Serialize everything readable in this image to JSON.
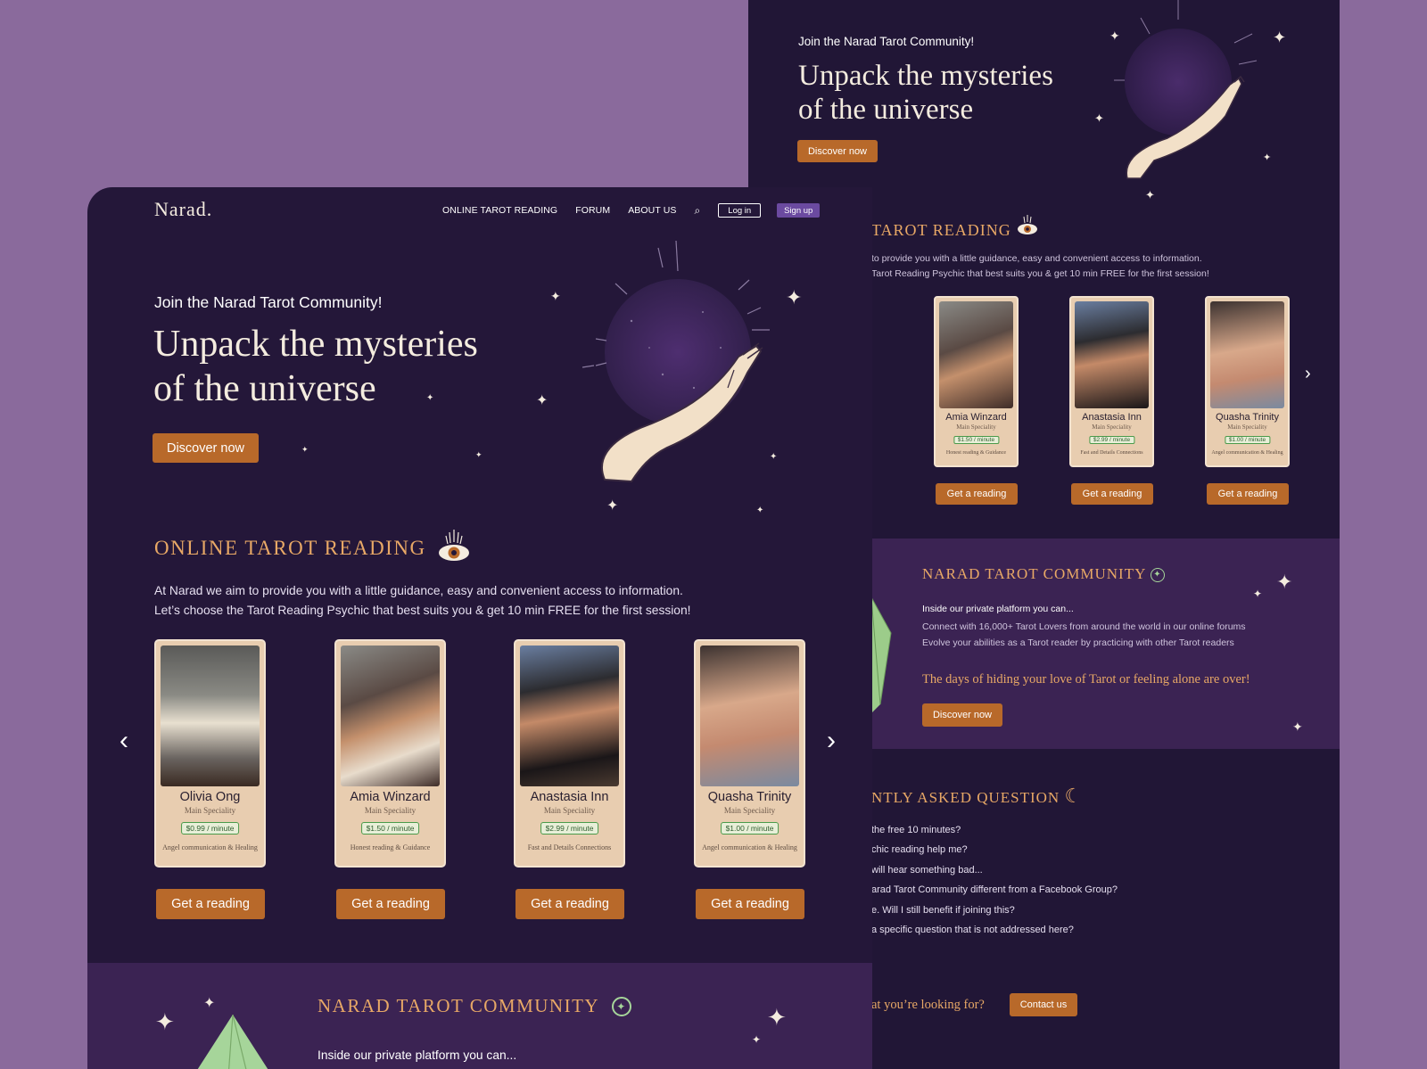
{
  "brand": {
    "logo": "Narad."
  },
  "nav": {
    "items": [
      "ONLINE TAROT READING",
      "FORUM",
      "ABOUT US"
    ],
    "login": "Log in",
    "signup": "Sign up"
  },
  "hero": {
    "kicker": "Join the Narad Tarot Community!",
    "title_line1": "Unpack the mysteries",
    "title_line2": "of the universe",
    "cta": "Discover now"
  },
  "reading": {
    "heading": "ONLINE TAROT READING",
    "desc_line1": "At Narad we aim to provide you with a little guidance, easy and convenient access to information.",
    "desc_line2": "Let’s choose the Tarot Reading Psychic that best suits you & get 10 min FREE for the first session!",
    "readers": [
      {
        "name": "Olivia Ong",
        "specialty_label": "Main Speciality",
        "price": "$0.99 / minute",
        "specialty": "Angel communication & Healing",
        "cta": "Get a reading"
      },
      {
        "name": "Amia Winzard",
        "specialty_label": "Main Speciality",
        "price": "$1.50 / minute",
        "specialty": "Honest reading & Guidance",
        "cta": "Get a reading"
      },
      {
        "name": "Anastasia Inn",
        "specialty_label": "Main Speciality",
        "price": "$2.99 / minute",
        "specialty": "Fast and Details Connections",
        "cta": "Get a reading"
      },
      {
        "name": "Quasha Trinity",
        "specialty_label": "Main Speciality",
        "price": "$1.00 / minute",
        "specialty": "Angel communication & Healing",
        "cta": "Get a reading"
      }
    ]
  },
  "community": {
    "heading": "NARAD TAROT COMMUNITY",
    "intro": "Inside our private platform you can...",
    "point1": "Connect with 16,000+ Tarot Lovers from around the world in our online forums",
    "point2": "Evolve your abilities as a Tarot reader by practicing with other Tarot readers",
    "quote": "The days of hiding your love of Tarot or feeling alone are over!",
    "cta": "Discover now"
  },
  "back": {
    "reading_heading_visible": "TAROT READING",
    "desc_line1_visible": "to provide you with a little guidance, easy and convenient access to information.",
    "desc_line2_visible": "Tarot Reading Psychic that best suits you & get 10 min FREE for the first session!",
    "faq_heading_visible": "NTLY ASKED QUESTION",
    "faq": [
      "the free 10 minutes?",
      "chic reading help me?",
      "will hear something bad...",
      "arad Tarot Community different from a Facebook Group?",
      "e. Will I still benefit if joining this?",
      "a specific question that is not addressed here?"
    ],
    "contact_prompt_visible": "at you’re looking for?",
    "contact_cta": "Contact us"
  },
  "colors": {
    "background": "#8a6a9c",
    "panel": "#241739",
    "band": "#3b2353",
    "accent_orange": "#b8692a",
    "heading_gold": "#e8a866",
    "card": "#e8cdb0"
  },
  "icons": [
    "search-icon",
    "eye-icon",
    "crescent-moon-icon",
    "pentacle-icon",
    "chevron-left-icon",
    "chevron-right-icon",
    "sparkle-icon",
    "hand-holding-moon-illustration",
    "crystal-illustration"
  ]
}
